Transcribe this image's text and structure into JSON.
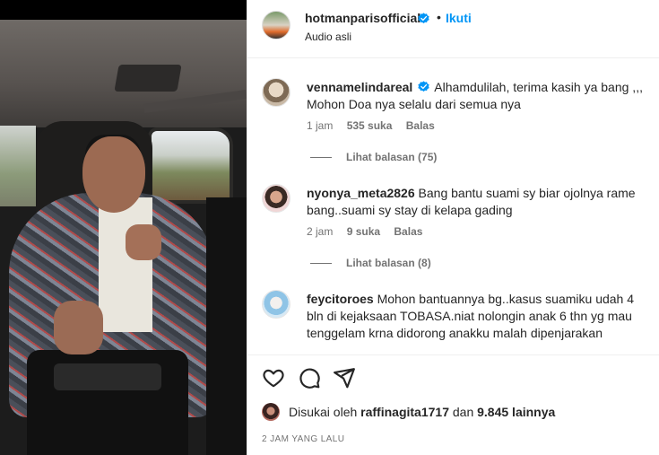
{
  "header": {
    "username": "hotmanparisofficial",
    "follow_label": "Ikuti",
    "separator": "•",
    "audio": "Audio asli"
  },
  "comments": [
    {
      "username": "vennamelindareal",
      "verified": true,
      "text": "Alhamdulilah, terima kasih ya bang ,,, Mohon Doa nya selalu dari semua nya",
      "time": "1 jam",
      "likes": "535 suka",
      "reply": "Balas",
      "view_replies": "Lihat balasan (75)"
    },
    {
      "username": "nyonya_meta2826",
      "verified": false,
      "text": "Bang bantu suami sy biar ojolnya rame bang..suami sy stay di kelapa gading",
      "time": "2 jam",
      "likes": "9 suka",
      "reply": "Balas",
      "view_replies": "Lihat balasan (8)"
    },
    {
      "username": "feycitoroes",
      "verified": false,
      "text": "Mohon bantuannya bg..kasus suamiku udah 4 bln di kejaksaan TOBASA.niat nolongin anak 6 thn yg mau tenggelam krna didorong anakku malah dipenjarakan"
    }
  ],
  "likes": {
    "prefix": "Disukai oleh",
    "user": "raffinagita1717",
    "middle": "dan",
    "count": "9.845 lainnya"
  },
  "timestamp": "2 JAM YANG LALU",
  "icons": [
    "heart-icon",
    "comment-icon",
    "share-icon",
    "verified-badge-icon"
  ],
  "colors": {
    "link": "#0095f6",
    "verified": "#0095f6",
    "muted": "#737373",
    "text": "#262626"
  }
}
